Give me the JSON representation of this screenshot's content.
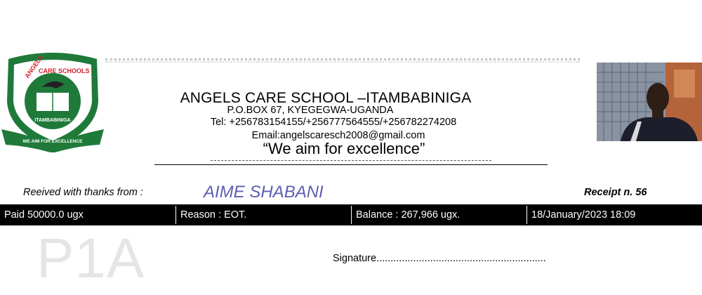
{
  "school": {
    "logo_top_text": "ANGELS CARE SCHOOLS",
    "logo_place": "ITAMBABINIGA",
    "logo_motto": "WE AIM FOR EXCELLENCE",
    "name": "ANGELS CARE SCHOOL –ITAMBABINIGA",
    "pobox": "P.O.BOX 67, KYEGEGWA-UGANDA",
    "tel": "Tel: +256783154155/+256777564555/+256782274208",
    "email": "Email:angelscaresch2008@gmail.com",
    "motto": "“We aim for excellence”"
  },
  "receipt": {
    "received_label": "Reeived with thanks from :",
    "payer_name": "AIME SHABANI",
    "number_label": "Receipt n. 56",
    "paid": "Paid 50000.0 ugx",
    "reason": "Reason : EOT.",
    "balance": "Balance : 267,966 ugx.",
    "date": "18/January/2023 18:09",
    "class_watermark": "P1A",
    "signature": "Signature............................................................"
  },
  "colors": {
    "logo_green": "#1f7a3a",
    "logo_red": "#d11f2b",
    "payer_name": "#5d5db3"
  }
}
